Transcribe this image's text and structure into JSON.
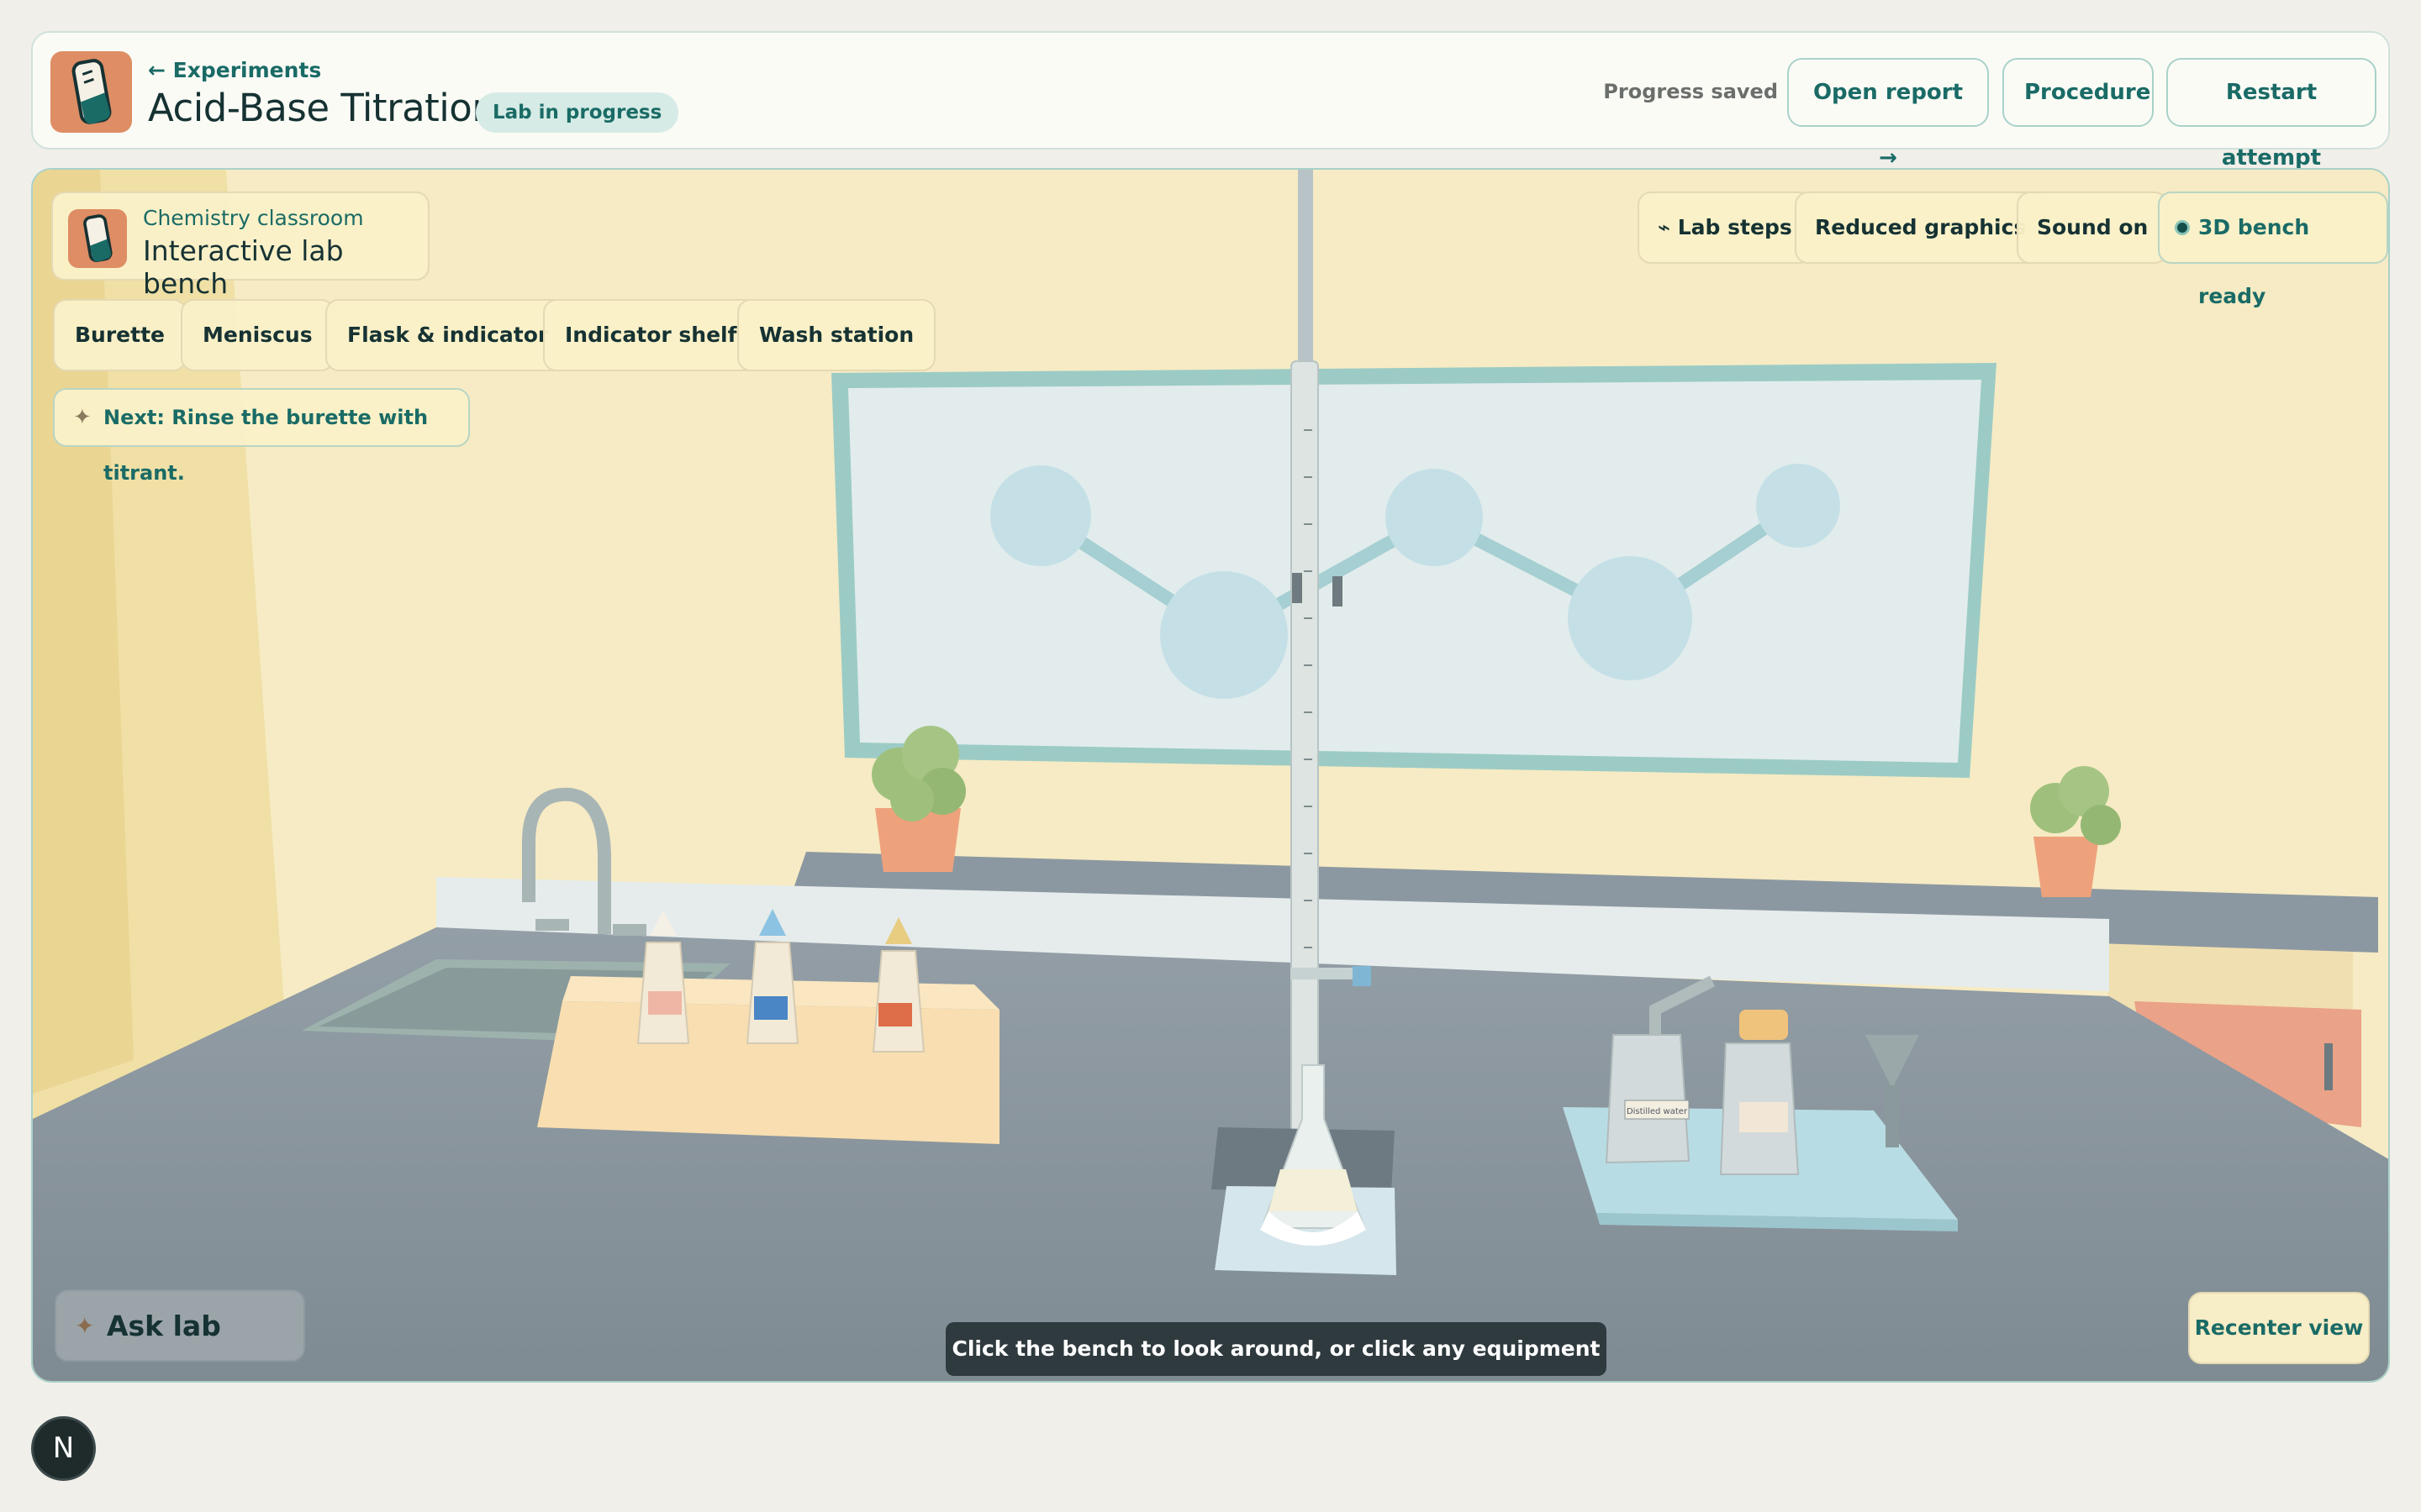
{
  "header": {
    "back_label": "← Experiments",
    "title": "Acid-Base Titration",
    "status": "Lab in progress",
    "saved": "Progress saved",
    "buttons": {
      "open_report": "Open report →",
      "procedure": "Procedure",
      "restart": "Restart attempt"
    }
  },
  "scene": {
    "classroom_sub": "Chemistry classroom",
    "classroom_title": "Interactive lab bench",
    "tools": [
      "Burette",
      "Meniscus",
      "Flask & indicator",
      "Indicator shelf",
      "Wash station"
    ],
    "next_hint": "Next: Rinse the burette with titrant.",
    "controls": {
      "lab_steps": "⌁ Lab steps",
      "graphics": "Reduced graphics",
      "sound": "Sound on",
      "ready": "3D bench ready"
    },
    "coach": "Ask lab coach",
    "tooltip": "Click the bench to look around, or click any equipment to use it.",
    "recenter": "Recenter view",
    "bottle_label": "Distilled water"
  },
  "user": {
    "avatar_letter": "N"
  },
  "colors": {
    "accent": "#1a6b66",
    "brand_icon": "#de8d64",
    "wall": "#f6ebc1",
    "bench": "#8e9aa3"
  }
}
